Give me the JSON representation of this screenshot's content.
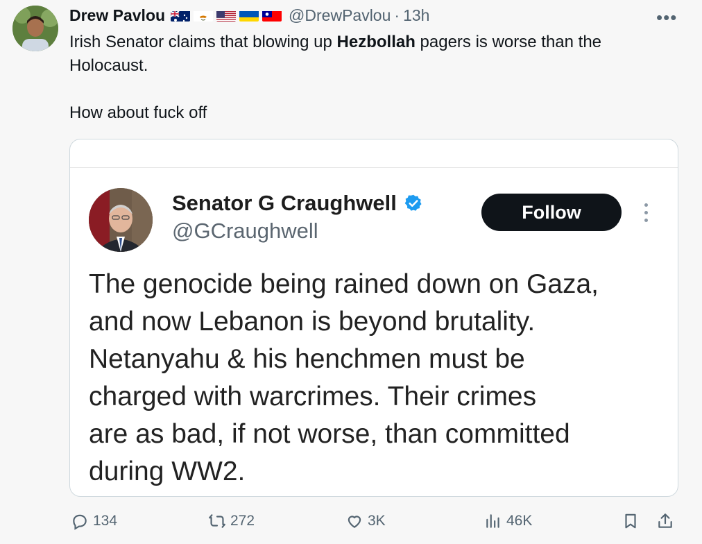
{
  "tweet": {
    "author_name": "Drew Pavlou",
    "handle": "@DrewPavlou",
    "separator": "·",
    "time": "13h",
    "flags": [
      "australia-flag",
      "cyprus-flag",
      "usa-flag",
      "ukraine-flag",
      "taiwan-flag"
    ],
    "text_line1_before": "Irish Senator claims that blowing up ",
    "text_line1_bold": "Hezbollah",
    "text_line1_after": " pagers is worse than the Holocaust.",
    "text_line2": "How about fuck off"
  },
  "quote": {
    "name": "Senator G Craughwell",
    "handle": "@GCraughwell",
    "follow_label": "Follow",
    "lines": [
      "The genocide being rained down on Gaza,",
      "and now Lebanon is beyond brutality.",
      "Netanyahu & his henchmen must be",
      "charged with warcrimes. Their crimes",
      "are as bad, if not worse, than committed",
      "during WW2."
    ]
  },
  "actions": {
    "replies": "134",
    "reposts": "272",
    "likes": "3K",
    "views": "46K"
  },
  "colors": {
    "follow_bg": "#0f1419",
    "verified": "#1d9bf0",
    "muted": "#536471"
  }
}
